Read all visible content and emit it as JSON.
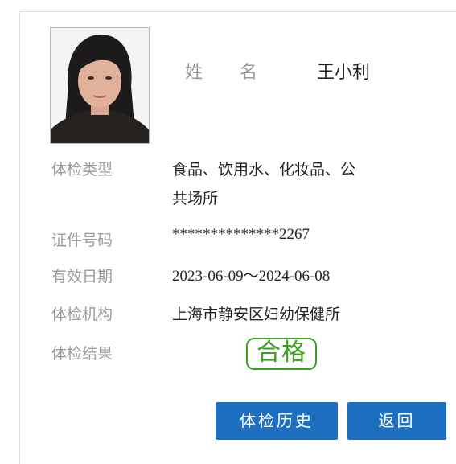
{
  "person": {
    "name_label_1": "姓",
    "name_label_2": "名",
    "name": "王小利"
  },
  "fields": {
    "type_label": "体检类型",
    "type_line1": "食品、饮用水、化妆品、公",
    "type_line2": "共场所",
    "id_label": "证件号码",
    "id_value": "**************2267",
    "validity_label": "有效日期",
    "validity_value": "2023-06-09～2024-06-08",
    "org_label": "体检机构",
    "org_value": "上海市静安区妇幼保健所",
    "result_label": "体检结果",
    "result_value": "合格"
  },
  "buttons": {
    "history": "体检历史",
    "back": "返回"
  },
  "colors": {
    "button_bg": "#1f6fc1",
    "stamp": "#3aa11f",
    "label": "#9a9a9a"
  }
}
